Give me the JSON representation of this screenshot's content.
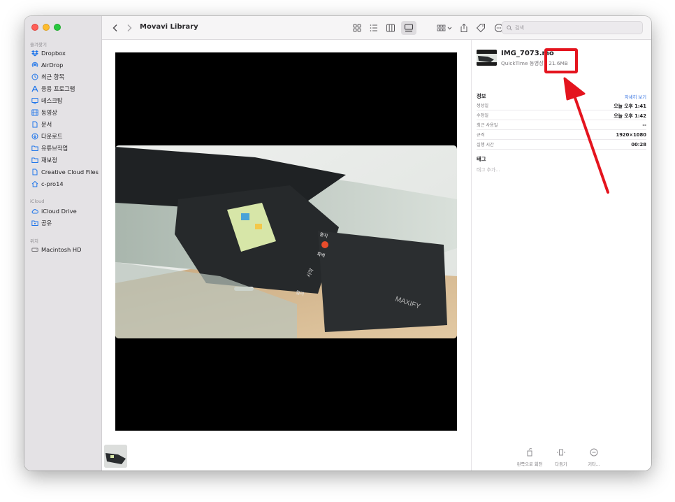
{
  "window": {
    "title": "Movavi Library"
  },
  "sidebar": {
    "sections": [
      {
        "label": "즐겨찾기",
        "items": [
          {
            "label": "Dropbox",
            "icon": "dropbox-icon"
          },
          {
            "label": "AirDrop",
            "icon": "airdrop-icon"
          },
          {
            "label": "최근 항목",
            "icon": "clock-icon"
          },
          {
            "label": "응용 프로그램",
            "icon": "applications-icon"
          },
          {
            "label": "데스크탑",
            "icon": "desktop-icon"
          },
          {
            "label": "동영상",
            "icon": "film-icon"
          },
          {
            "label": "문서",
            "icon": "document-icon"
          },
          {
            "label": "다운로드",
            "icon": "download-icon"
          },
          {
            "label": "유튜브작업",
            "icon": "folder-icon"
          },
          {
            "label": "재보정",
            "icon": "folder-icon"
          },
          {
            "label": "Creative Cloud Files",
            "icon": "creative-cloud-icon"
          },
          {
            "label": "c-pro14",
            "icon": "home-icon"
          }
        ]
      },
      {
        "label": "iCloud",
        "items": [
          {
            "label": "iCloud Drive",
            "icon": "cloud-icon"
          },
          {
            "label": "공유",
            "icon": "shared-folder-icon"
          }
        ]
      },
      {
        "label": "위치",
        "items": [
          {
            "label": "Macintosh HD",
            "icon": "disk-icon"
          }
        ]
      }
    ]
  },
  "toolbar": {
    "title": "Movavi Library",
    "search_placeholder": "검색"
  },
  "inspector": {
    "filename": "IMG_7073.mo",
    "kind": "QuickTime 동영상 - 21.6MB",
    "info_heading": "정보",
    "more_link": "자세히 보기",
    "rows": [
      {
        "key": "생성일",
        "value": "오늘 오후 1:41"
      },
      {
        "key": "수정일",
        "value": "오늘 오후 1:42"
      },
      {
        "key": "최근 사용일",
        "value": "--"
      },
      {
        "key": "규격",
        "value": "1920×1080"
      },
      {
        "key": "실행 시간",
        "value": "00:28"
      }
    ],
    "tags_heading": "태그",
    "tags_placeholder": "태그 추가...",
    "actions": [
      {
        "label": "왼쪽으로 회전",
        "icon": "rotate-left-icon"
      },
      {
        "label": "다듬기",
        "icon": "trim-icon"
      },
      {
        "label": "기타...",
        "icon": "more-icon"
      }
    ]
  },
  "preview": {
    "screen_labels": [
      "중지",
      "흑백",
      "시작",
      "컬러"
    ],
    "brand": "MAXIFY"
  },
  "colors": {
    "highlight": "#e4141e",
    "accent": "#1f75ea"
  }
}
